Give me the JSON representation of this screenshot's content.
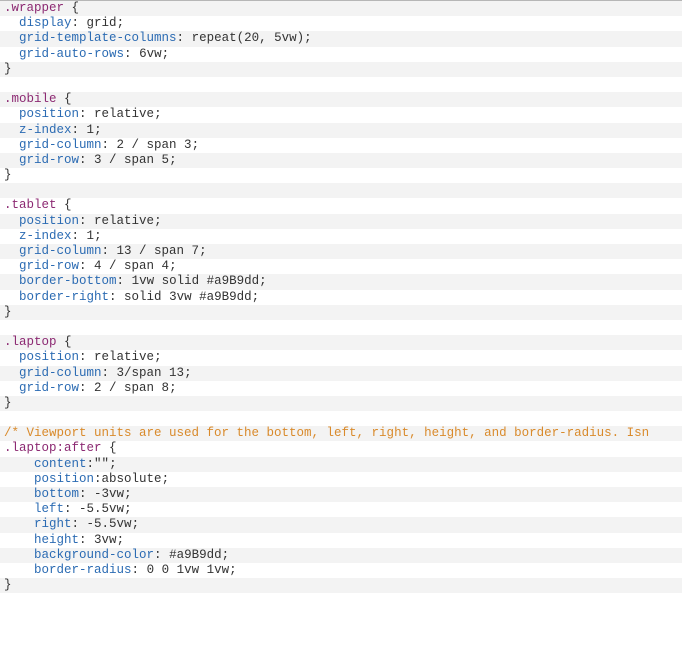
{
  "code": {
    "lines": [
      {
        "text": ".wrapper {",
        "tokens": [
          [
            "selector",
            ".wrapper"
          ],
          [
            "punc",
            " {"
          ]
        ]
      },
      {
        "text": "  display: grid;",
        "tokens": [
          [
            "punc",
            "  "
          ],
          [
            "prop",
            "display"
          ],
          [
            "punc",
            ": "
          ],
          [
            "value",
            "grid"
          ],
          [
            "punc",
            ";"
          ]
        ]
      },
      {
        "text": "  grid-template-columns: repeat(20, 5vw);",
        "tokens": [
          [
            "punc",
            "  "
          ],
          [
            "prop",
            "grid-template-columns"
          ],
          [
            "punc",
            ": "
          ],
          [
            "func",
            "repeat"
          ],
          [
            "punc",
            "("
          ],
          [
            "num",
            "20"
          ],
          [
            "punc",
            ", "
          ],
          [
            "num",
            "5vw"
          ],
          [
            "punc",
            ");"
          ]
        ]
      },
      {
        "text": "  grid-auto-rows: 6vw;",
        "tokens": [
          [
            "punc",
            "  "
          ],
          [
            "prop",
            "grid-auto-rows"
          ],
          [
            "punc",
            ": "
          ],
          [
            "num",
            "6vw"
          ],
          [
            "punc",
            ";"
          ]
        ]
      },
      {
        "text": "}",
        "tokens": [
          [
            "punc",
            "}"
          ]
        ]
      },
      {
        "text": "",
        "tokens": []
      },
      {
        "text": ".mobile {",
        "tokens": [
          [
            "selector",
            ".mobile"
          ],
          [
            "punc",
            " {"
          ]
        ]
      },
      {
        "text": "  position: relative;",
        "tokens": [
          [
            "punc",
            "  "
          ],
          [
            "prop",
            "position"
          ],
          [
            "punc",
            ": "
          ],
          [
            "value",
            "relative"
          ],
          [
            "punc",
            ";"
          ]
        ]
      },
      {
        "text": "  z-index: 1;",
        "tokens": [
          [
            "punc",
            "  "
          ],
          [
            "prop",
            "z-index"
          ],
          [
            "punc",
            ": "
          ],
          [
            "num",
            "1"
          ],
          [
            "punc",
            ";"
          ]
        ]
      },
      {
        "text": "  grid-column: 2 / span 3;",
        "tokens": [
          [
            "punc",
            "  "
          ],
          [
            "prop",
            "grid-column"
          ],
          [
            "punc",
            ": "
          ],
          [
            "num",
            "2 / span 3"
          ],
          [
            "punc",
            ";"
          ]
        ]
      },
      {
        "text": "  grid-row: 3 / span 5;",
        "tokens": [
          [
            "punc",
            "  "
          ],
          [
            "prop",
            "grid-row"
          ],
          [
            "punc",
            ": "
          ],
          [
            "num",
            "3 / span 5"
          ],
          [
            "punc",
            ";"
          ]
        ]
      },
      {
        "text": "}",
        "tokens": [
          [
            "punc",
            "}"
          ]
        ]
      },
      {
        "text": "",
        "tokens": []
      },
      {
        "text": ".tablet {",
        "tokens": [
          [
            "selector",
            ".tablet"
          ],
          [
            "punc",
            " {"
          ]
        ]
      },
      {
        "text": "  position: relative;",
        "tokens": [
          [
            "punc",
            "  "
          ],
          [
            "prop",
            "position"
          ],
          [
            "punc",
            ": "
          ],
          [
            "value",
            "relative"
          ],
          [
            "punc",
            ";"
          ]
        ]
      },
      {
        "text": "  z-index: 1;",
        "tokens": [
          [
            "punc",
            "  "
          ],
          [
            "prop",
            "z-index"
          ],
          [
            "punc",
            ": "
          ],
          [
            "num",
            "1"
          ],
          [
            "punc",
            ";"
          ]
        ]
      },
      {
        "text": "  grid-column: 13 / span 7;",
        "tokens": [
          [
            "punc",
            "  "
          ],
          [
            "prop",
            "grid-column"
          ],
          [
            "punc",
            ": "
          ],
          [
            "num",
            "13 / span 7"
          ],
          [
            "punc",
            ";"
          ]
        ]
      },
      {
        "text": "  grid-row: 4 / span 4;",
        "tokens": [
          [
            "punc",
            "  "
          ],
          [
            "prop",
            "grid-row"
          ],
          [
            "punc",
            ": "
          ],
          [
            "num",
            "4 / span 4"
          ],
          [
            "punc",
            ";"
          ]
        ]
      },
      {
        "text": "  border-bottom: 1vw solid #a9B9dd;",
        "tokens": [
          [
            "punc",
            "  "
          ],
          [
            "prop",
            "border-bottom"
          ],
          [
            "punc",
            ": "
          ],
          [
            "num",
            "1vw solid "
          ],
          [
            "hex",
            "#a9B9dd"
          ],
          [
            "punc",
            ";"
          ]
        ]
      },
      {
        "text": "  border-right: solid 3vw #a9B9dd;",
        "tokens": [
          [
            "punc",
            "  "
          ],
          [
            "prop",
            "border-right"
          ],
          [
            "punc",
            ": "
          ],
          [
            "value",
            "solid "
          ],
          [
            "num",
            "3vw "
          ],
          [
            "hex",
            "#a9B9dd"
          ],
          [
            "punc",
            ";"
          ]
        ]
      },
      {
        "text": "}",
        "tokens": [
          [
            "punc",
            "}"
          ]
        ]
      },
      {
        "text": "",
        "tokens": []
      },
      {
        "text": ".laptop {",
        "tokens": [
          [
            "selector",
            ".laptop"
          ],
          [
            "punc",
            " {"
          ]
        ]
      },
      {
        "text": "  position: relative;",
        "tokens": [
          [
            "punc",
            "  "
          ],
          [
            "prop",
            "position"
          ],
          [
            "punc",
            ": "
          ],
          [
            "value",
            "relative"
          ],
          [
            "punc",
            ";"
          ]
        ]
      },
      {
        "text": "  grid-column: 3/span 13;",
        "tokens": [
          [
            "punc",
            "  "
          ],
          [
            "prop",
            "grid-column"
          ],
          [
            "punc",
            ": "
          ],
          [
            "num",
            "3/span 13"
          ],
          [
            "punc",
            ";"
          ]
        ]
      },
      {
        "text": "  grid-row: 2 / span 8;",
        "tokens": [
          [
            "punc",
            "  "
          ],
          [
            "prop",
            "grid-row"
          ],
          [
            "punc",
            ": "
          ],
          [
            "num",
            "2 / span 8"
          ],
          [
            "punc",
            ";"
          ]
        ]
      },
      {
        "text": "}",
        "tokens": [
          [
            "punc",
            "}"
          ]
        ]
      },
      {
        "text": "",
        "tokens": []
      },
      {
        "text": "/* Viewport units are used for the bottom, left, right, height, and border-radius. Isn",
        "tokens": [
          [
            "comment",
            "/* Viewport units are used for the bottom, left, right, height, and border-radius. Isn"
          ]
        ]
      },
      {
        "text": ".laptop:after {",
        "tokens": [
          [
            "selector",
            ".laptop:after"
          ],
          [
            "punc",
            " {"
          ]
        ]
      },
      {
        "text": "    content:\"\";",
        "tokens": [
          [
            "punc",
            "    "
          ],
          [
            "prop",
            "content"
          ],
          [
            "punc",
            ":"
          ],
          [
            "str",
            "\"\""
          ],
          [
            "punc",
            ";"
          ]
        ]
      },
      {
        "text": "    position:absolute;",
        "tokens": [
          [
            "punc",
            "    "
          ],
          [
            "prop",
            "position"
          ],
          [
            "punc",
            ":"
          ],
          [
            "value",
            "absolute"
          ],
          [
            "punc",
            ";"
          ]
        ]
      },
      {
        "text": "    bottom: -3vw;",
        "tokens": [
          [
            "punc",
            "    "
          ],
          [
            "prop",
            "bottom"
          ],
          [
            "punc",
            ": "
          ],
          [
            "num",
            "-3vw"
          ],
          [
            "punc",
            ";"
          ]
        ]
      },
      {
        "text": "    left: -5.5vw;",
        "tokens": [
          [
            "punc",
            "    "
          ],
          [
            "prop",
            "left"
          ],
          [
            "punc",
            ": "
          ],
          [
            "num",
            "-5.5vw"
          ],
          [
            "punc",
            ";"
          ]
        ]
      },
      {
        "text": "    right: -5.5vw;",
        "tokens": [
          [
            "punc",
            "    "
          ],
          [
            "prop",
            "right"
          ],
          [
            "punc",
            ": "
          ],
          [
            "num",
            "-5.5vw"
          ],
          [
            "punc",
            ";"
          ]
        ]
      },
      {
        "text": "    height: 3vw;",
        "tokens": [
          [
            "punc",
            "    "
          ],
          [
            "prop",
            "height"
          ],
          [
            "punc",
            ": "
          ],
          [
            "num",
            "3vw"
          ],
          [
            "punc",
            ";"
          ]
        ]
      },
      {
        "text": "    background-color: #a9B9dd;",
        "tokens": [
          [
            "punc",
            "    "
          ],
          [
            "prop",
            "background-color"
          ],
          [
            "punc",
            ": "
          ],
          [
            "hex",
            "#a9B9dd"
          ],
          [
            "punc",
            ";"
          ]
        ]
      },
      {
        "text": "    border-radius: 0 0 1vw 1vw;",
        "tokens": [
          [
            "punc",
            "    "
          ],
          [
            "prop",
            "border-radius"
          ],
          [
            "punc",
            ": "
          ],
          [
            "num",
            "0 0 1vw 1vw"
          ],
          [
            "punc",
            ";"
          ]
        ]
      },
      {
        "text": "}",
        "tokens": [
          [
            "punc",
            "}"
          ]
        ]
      }
    ]
  }
}
